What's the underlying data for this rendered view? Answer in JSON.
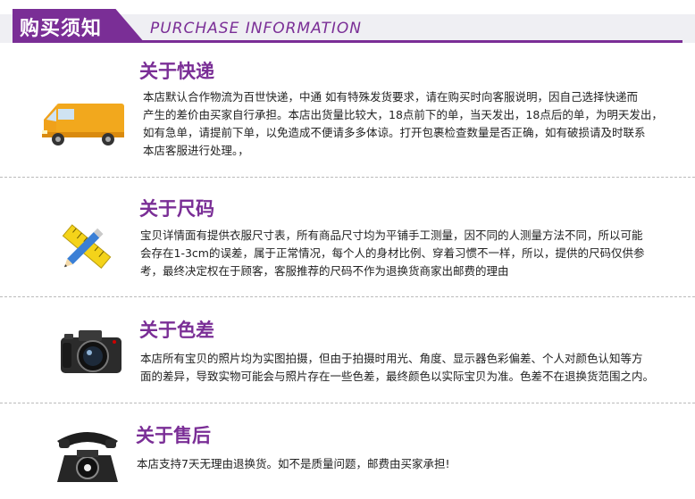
{
  "header": {
    "title_cn": "购买须知",
    "title_en": "PURCHASE INFORMATION"
  },
  "sections": [
    {
      "icon": "van-icon",
      "title": "关于快递",
      "lines": [
        "本店默认合作物流为百世快递，中通 如有特殊发货要求，请在购买时向客服说明，因自己选择快递而",
        "产生的差价由买家自行承担。本店出货量比较大，18点前下的单，当天发出，18点后的单，为明天发出，",
        "如有急单，请提前下单，以免造成不便请多多体谅。打开包裹检查数量是否正确，如有破损请及时联系",
        "本店客服进行处理。，"
      ]
    },
    {
      "icon": "ruler-pencil-icon",
      "title": "关于尺码",
      "lines": [
        "宝贝详情面有提供衣服尺寸表，所有商品尺寸均为平铺手工测量，因不同的人测量方法不同，所以可能",
        "会存在1-3cm的误差，属于正常情况，每个人的身材比例、穿着习惯不一样，所以，提供的尺码仅供参",
        "考，最终决定权在于顾客，客服推荐的尺码不作为退换货商家出邮费的理由"
      ]
    },
    {
      "icon": "camera-icon",
      "title": "关于色差",
      "lines": [
        "本店所有宝贝的照片均为实图拍摄，但由于拍摄时用光、角度、显示器色彩偏差、个人对颜色认知等方",
        "面的差异，导致实物可能会与照片存在一些色差，最终颜色以实际宝贝为准。色差不在退换货范围之内。"
      ]
    },
    {
      "icon": "telephone-icon",
      "title": "关于售后",
      "lines": [
        "本店支持7天无理由退换货。如不是质量问题，邮费由买家承担!"
      ]
    }
  ],
  "colors": {
    "accent": "#7a2e96",
    "van": "#f2a81d"
  }
}
